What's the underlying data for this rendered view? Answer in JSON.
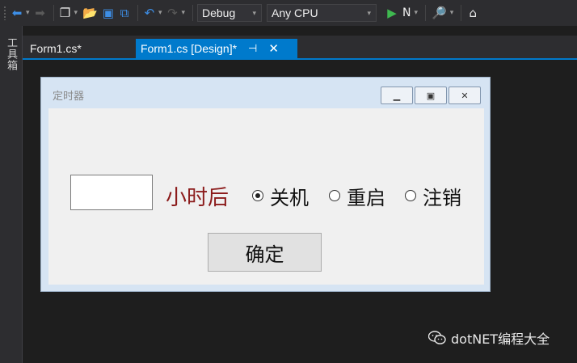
{
  "toolbar": {
    "config_combo": "Debug",
    "platform_combo": "Any CPU",
    "start_label": "N"
  },
  "sidebar": {
    "toolbox_label": "工具箱"
  },
  "tabs": [
    {
      "label": "Form1.cs*"
    },
    {
      "label": "Form1.cs [Design]*"
    }
  ],
  "form": {
    "title": "定时器",
    "hours_label": "小时后",
    "textbox_value": "",
    "radios": [
      {
        "label": "关机",
        "checked": true
      },
      {
        "label": "重启",
        "checked": false
      },
      {
        "label": "注销",
        "checked": false
      }
    ],
    "ok_label": "确定"
  },
  "watermark": {
    "text": "dotNET编程大全"
  },
  "icons": {
    "back": "back-icon",
    "forward": "forward-icon",
    "new_project": "new-project-icon",
    "open": "open-folder-icon",
    "save": "save-icon",
    "save_all": "save-all-icon",
    "undo": "undo-icon",
    "redo": "redo-icon",
    "start": "play-icon",
    "find": "find-in-files-icon",
    "home": "home-icon"
  },
  "colors": {
    "accent": "#007acc",
    "hours_label": "#8b1a1a",
    "ide_background": "#1e1e1e"
  }
}
